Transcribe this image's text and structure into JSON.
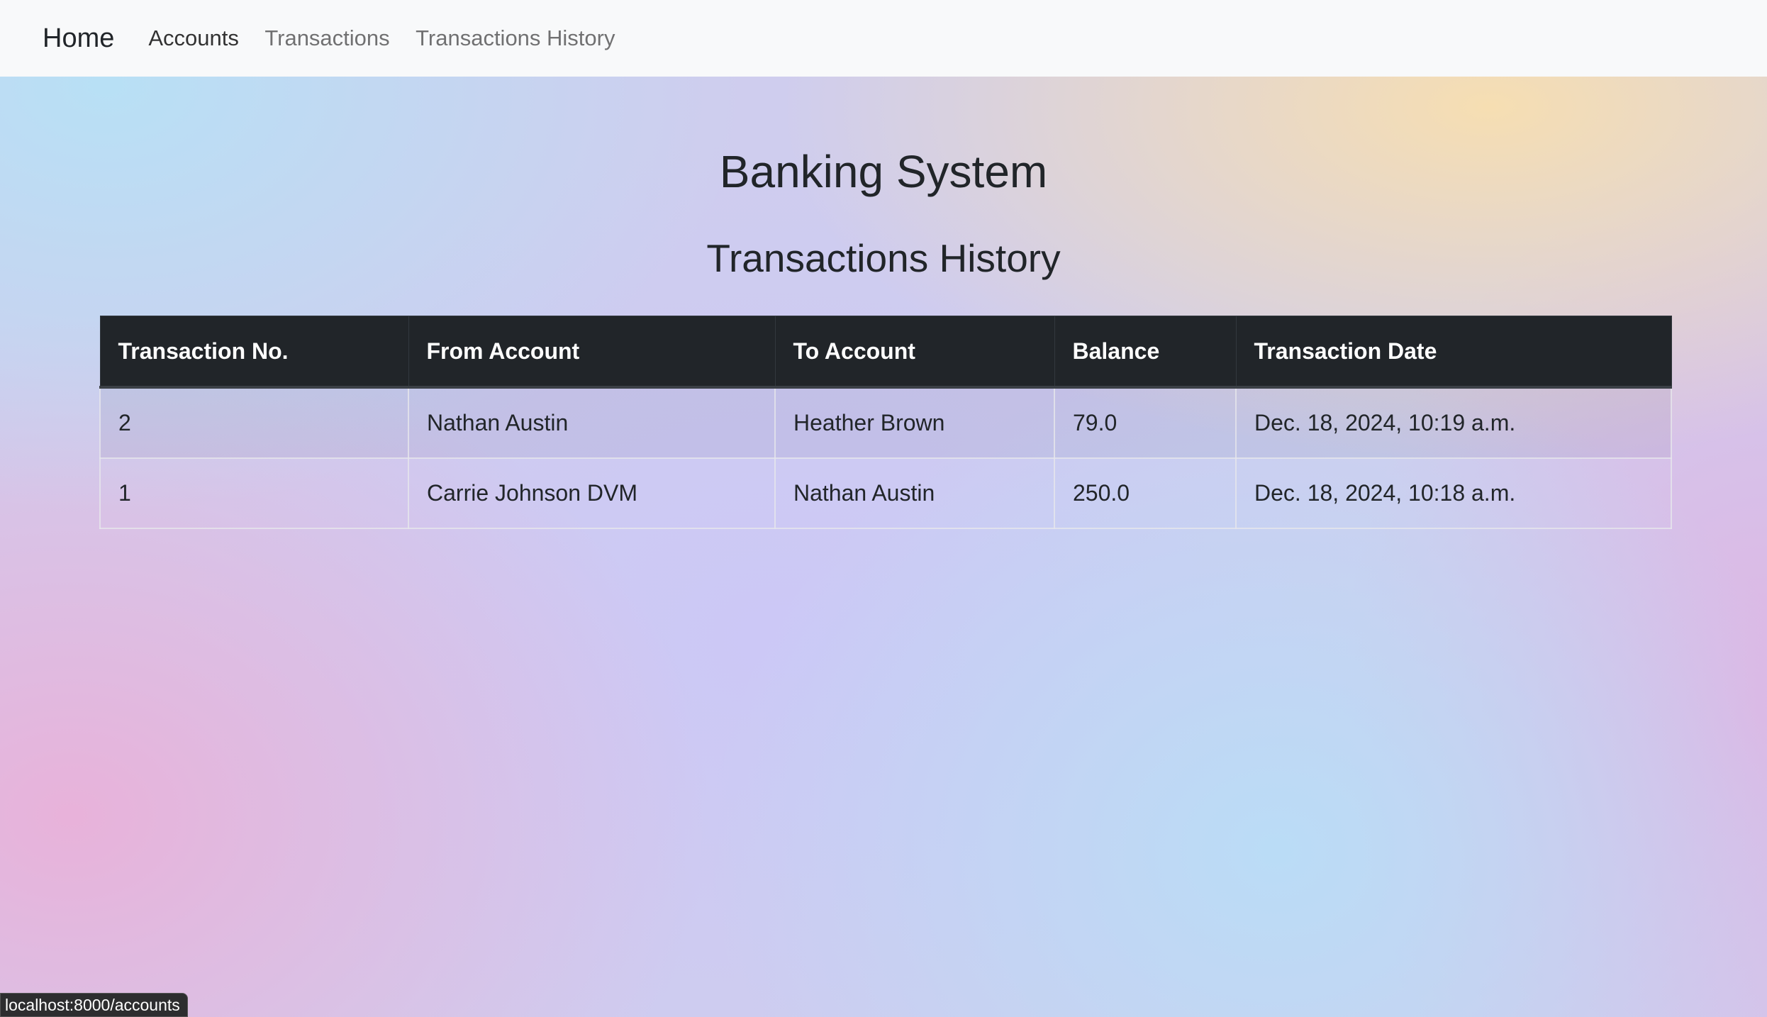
{
  "navbar": {
    "brand": "Home",
    "links": [
      {
        "label": "Accounts"
      },
      {
        "label": "Transactions"
      },
      {
        "label": "Transactions History"
      }
    ]
  },
  "page": {
    "title": "Banking System",
    "subtitle": "Transactions History"
  },
  "table": {
    "headers": [
      "Transaction No.",
      "From Account",
      "To Account",
      "Balance",
      "Transaction Date"
    ],
    "rows": [
      [
        "2",
        "Nathan Austin",
        "Heather Brown",
        "79.0",
        "Dec. 18, 2024, 10:19 a.m."
      ],
      [
        "1",
        "Carrie Johnson DVM",
        "Nathan Austin",
        "250.0",
        "Dec. 18, 2024, 10:18 a.m."
      ]
    ]
  },
  "status_bar": {
    "url": "localhost:8000/accounts"
  }
}
